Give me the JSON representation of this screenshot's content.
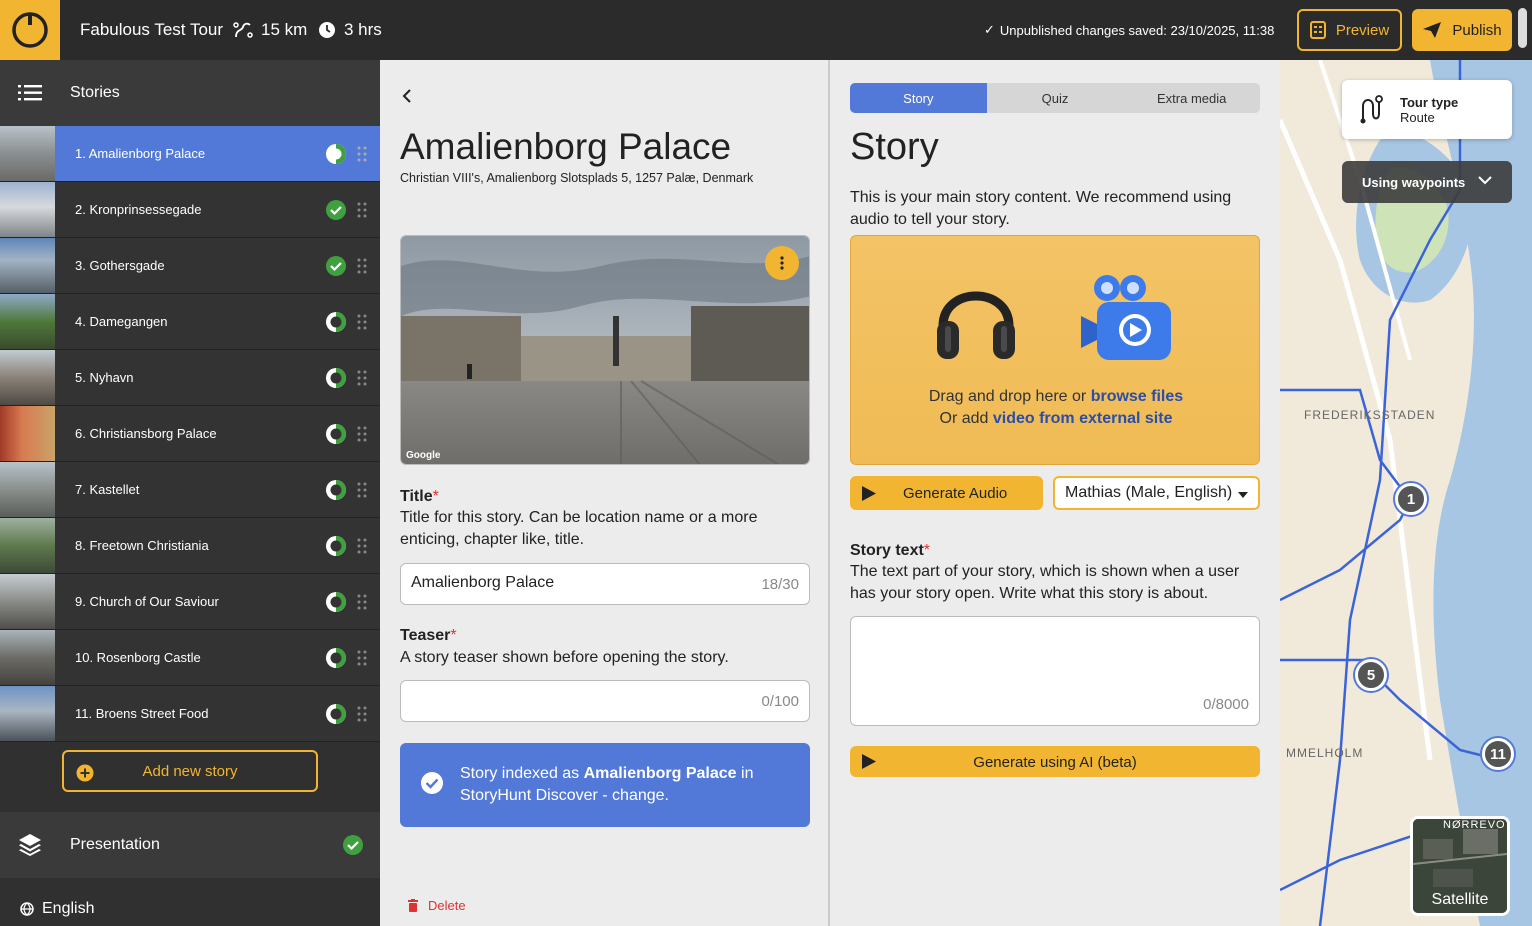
{
  "header": {
    "tour_title": "Fabulous Test Tour",
    "distance": "15 km",
    "duration": "3 hrs",
    "saved_status": "Unpublished changes saved: 23/10/2025, 11:38",
    "preview_label": "Preview",
    "publish_label": "Publish",
    "accent_color": "#f2b531"
  },
  "sidebar": {
    "stories_label": "Stories",
    "items": [
      {
        "label": "1. Amalienborg Palace",
        "status": "partial"
      },
      {
        "label": "2. Kronprinsessegade",
        "status": "done"
      },
      {
        "label": "3. Gothersgade",
        "status": "done"
      },
      {
        "label": "4. Damegangen",
        "status": "partial"
      },
      {
        "label": "5. Nyhavn",
        "status": "partial"
      },
      {
        "label": "6. Christiansborg Palace",
        "status": "partial"
      },
      {
        "label": "7. Kastellet",
        "status": "partial"
      },
      {
        "label": "8. Freetown Christiania",
        "status": "partial"
      },
      {
        "label": "9. Church of Our Saviour",
        "status": "partial"
      },
      {
        "label": "10. Rosenborg Castle",
        "status": "partial"
      },
      {
        "label": "11. Broens Street Food",
        "status": "partial"
      }
    ],
    "add_story_label": "Add new story",
    "presentation_label": "Presentation",
    "language_label": "English",
    "active_color": "#5279d8"
  },
  "editor": {
    "place_title": "Amalienborg Palace",
    "address": "Christian VIII's, Amalienborg Slotsplads 5, 1257 Palæ, Denmark",
    "photo_credit": "Google",
    "title_label": "Title",
    "title_help": "Title for this story. Can be location name or a more enticing, chapter like, title.",
    "title_value": "Amalienborg Palace",
    "title_counter": "18/30",
    "teaser_label": "Teaser",
    "teaser_help": "A story teaser shown before opening the story.",
    "teaser_value": "",
    "teaser_counter": "0/100",
    "indexed_prefix": "Story indexed as ",
    "indexed_name": "Amalienborg Palace",
    "indexed_suffix": " in StoryHunt Discover - change.",
    "delete_label": "Delete"
  },
  "story_panel": {
    "tabs": [
      {
        "label": "Story",
        "active": true
      },
      {
        "label": "Quiz",
        "active": false
      },
      {
        "label": "Extra media",
        "active": false
      }
    ],
    "heading": "Story",
    "description": "This is your main story content. We recommend using audio to tell your story.",
    "drop_prefix": "Drag and drop here or ",
    "drop_link": "browse files",
    "video_prefix": "Or add ",
    "video_link": "video from external site",
    "generate_audio_label": "Generate Audio",
    "voice_value": "Mathias (Male, English)",
    "story_text_label": "Story text",
    "story_text_help": "The text part of your story, which is shown when a user has your story open. Write what this story is about.",
    "story_text_counter": "0/8000",
    "generate_ai_label": "Generate using AI (beta)"
  },
  "map": {
    "tour_type_label": "Tour type",
    "tour_type_value": "Route",
    "waypoints_label": "Using waypoints",
    "satellite_label": "Satellite",
    "district_label": "FREDERIKSSTADEN",
    "district2_label": "NØRREVO",
    "district3_label": "MMELHOLM",
    "markers": [
      "1",
      "5",
      "11"
    ]
  }
}
